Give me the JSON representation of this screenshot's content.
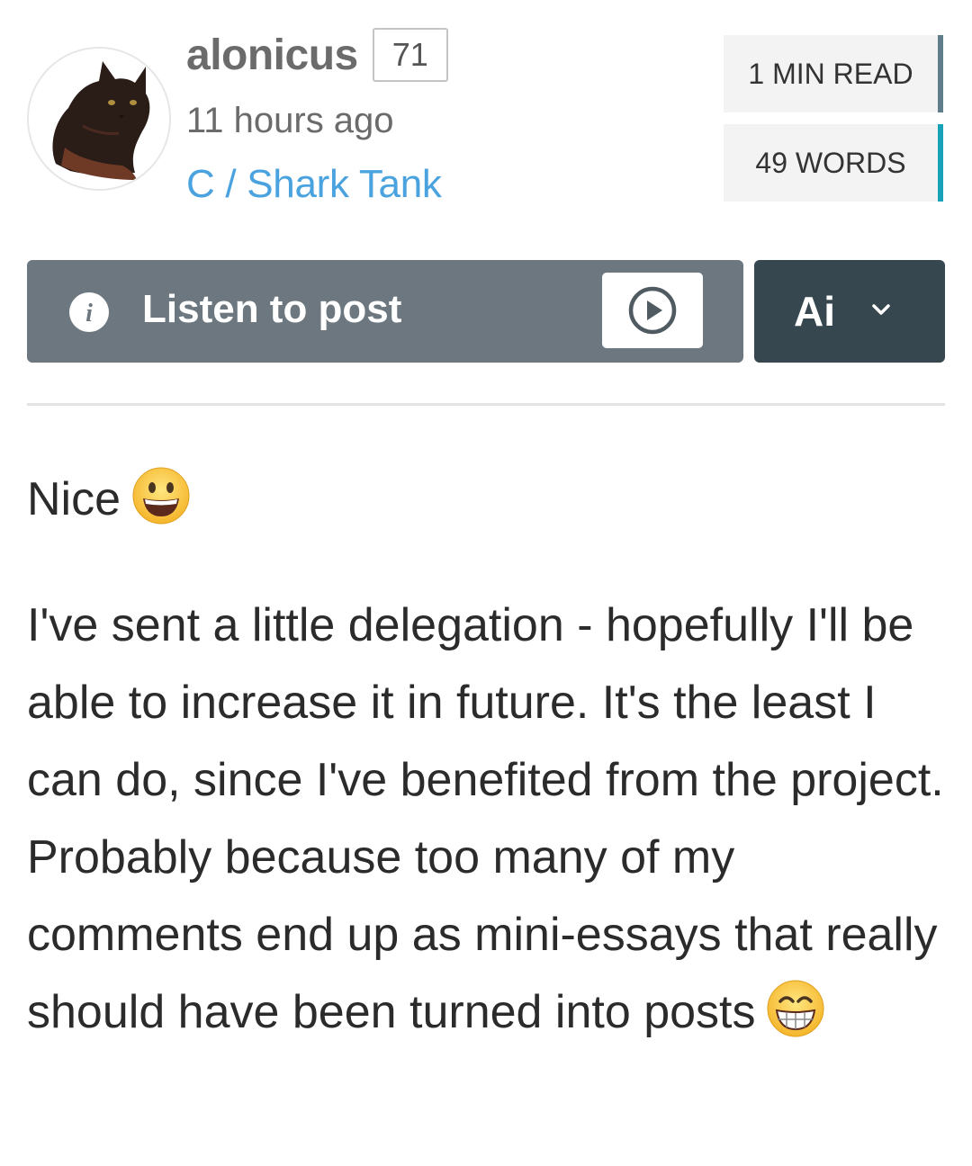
{
  "author": {
    "username": "alonicus",
    "reputation": "71",
    "timestamp": "11 hours ago",
    "community": "C / Shark Tank",
    "avatar_icon": "cat-avatar"
  },
  "stats": {
    "read_time": "1 MIN READ",
    "word_count": "49 WORDS"
  },
  "listen": {
    "label": "Listen to post",
    "info_icon": "info-icon",
    "play_icon": "play-circle-icon"
  },
  "ai_menu": {
    "label": "Ai",
    "icon": "chevron-down-icon"
  },
  "post": {
    "paragraph_1": "Nice",
    "paragraph_1_emoji": "grinning-face-emoji",
    "paragraph_2": "I've sent a little delegation - hopefully I'll be able to increase it in future. It's the least I can do, since I've benefited from the project. Probably because too many of my comments end up as mini-essays that really should have been turned into posts",
    "paragraph_2_emoji": "beaming-face-emoji"
  },
  "colors": {
    "community_link": "#4aa3df",
    "listen_bar": "#6c777f",
    "ai_bar": "#37474f",
    "read_accent": "#607d8b",
    "words_accent": "#17a2b8"
  }
}
